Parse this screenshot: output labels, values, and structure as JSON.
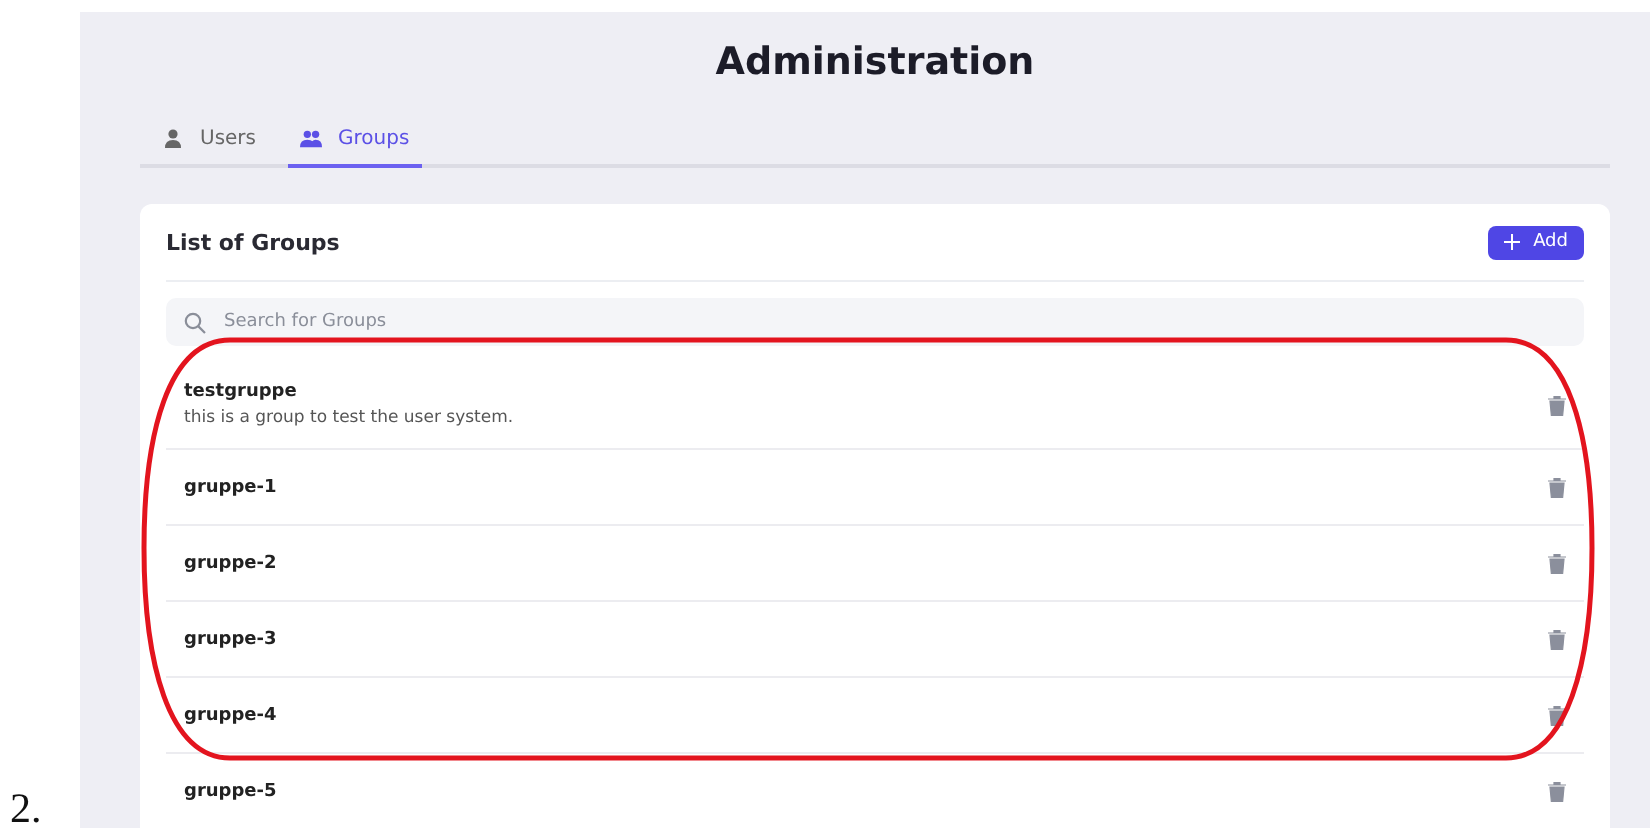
{
  "list_markers": [
    "2."
  ],
  "page": {
    "title": "Administration"
  },
  "tabs": [
    {
      "label": "Users",
      "selected": false
    },
    {
      "label": "Groups",
      "selected": true
    }
  ],
  "card": {
    "title": "List of Groups",
    "add_button": "Add",
    "search": {
      "placeholder": "Search for Groups"
    }
  },
  "groups": [
    {
      "name": "testgruppe",
      "description": "this is a group to test the user system."
    },
    {
      "name": "gruppe-1"
    },
    {
      "name": "gruppe-2"
    },
    {
      "name": "gruppe-3"
    },
    {
      "name": "gruppe-4"
    },
    {
      "name": "gruppe-5"
    }
  ],
  "annotation": {
    "kind": "ellipse",
    "color": "#e3141e"
  }
}
